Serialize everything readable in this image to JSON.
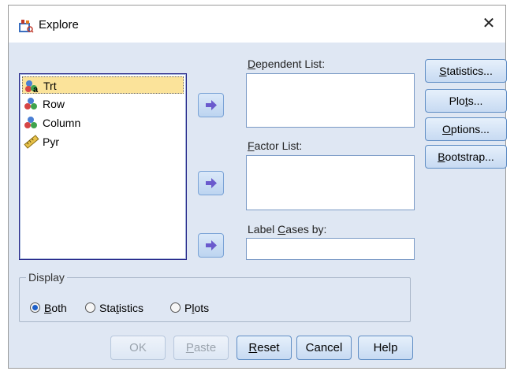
{
  "window": {
    "title": "Explore",
    "close_glyph": "✕"
  },
  "variables": [
    {
      "label": "Trt",
      "icon": "nominal-variable-icon",
      "selected": true
    },
    {
      "label": "Row",
      "icon": "nominal-variable-icon",
      "selected": false
    },
    {
      "label": "Column",
      "icon": "nominal-variable-icon",
      "selected": false
    },
    {
      "label": "Pyr",
      "icon": "scale-variable-icon",
      "selected": false
    }
  ],
  "fields": {
    "dependent": {
      "label_pre": "",
      "label_key": "D",
      "label_post": "ependent List:"
    },
    "factor": {
      "label_pre": "",
      "label_key": "F",
      "label_post": "actor List:"
    },
    "label_cases": {
      "label_pre": "Label ",
      "label_key": "C",
      "label_post": "ases by:"
    }
  },
  "side_buttons": {
    "statistics": {
      "pre": "",
      "key": "S",
      "post": "tatistics..."
    },
    "plots": {
      "pre": "Plo",
      "key": "t",
      "post": "s..."
    },
    "options": {
      "pre": "",
      "key": "O",
      "post": "ptions..."
    },
    "bootstrap": {
      "pre": "",
      "key": "B",
      "post": "ootstrap..."
    }
  },
  "display": {
    "legend": "Display",
    "options": [
      {
        "pre": "",
        "key": "B",
        "post": "oth",
        "checked": true
      },
      {
        "pre": "Sta",
        "key": "t",
        "post": "istics",
        "checked": false
      },
      {
        "pre": "P",
        "key": "l",
        "post": "ots",
        "checked": false
      }
    ]
  },
  "buttons": {
    "ok": {
      "pre": "OK",
      "key": "",
      "post": ""
    },
    "paste": {
      "pre": "",
      "key": "P",
      "post": "aste"
    },
    "reset": {
      "pre": "",
      "key": "R",
      "post": "eset"
    },
    "cancel": {
      "pre": "Cancel",
      "key": "",
      "post": ""
    },
    "help": {
      "pre": "Help",
      "key": "",
      "post": ""
    }
  },
  "colors": {
    "accent": "#1c5fc9",
    "selected_row": "#fbe39a",
    "arrow": "#6a5acd",
    "dialog_bg": "#dfe7f3"
  }
}
